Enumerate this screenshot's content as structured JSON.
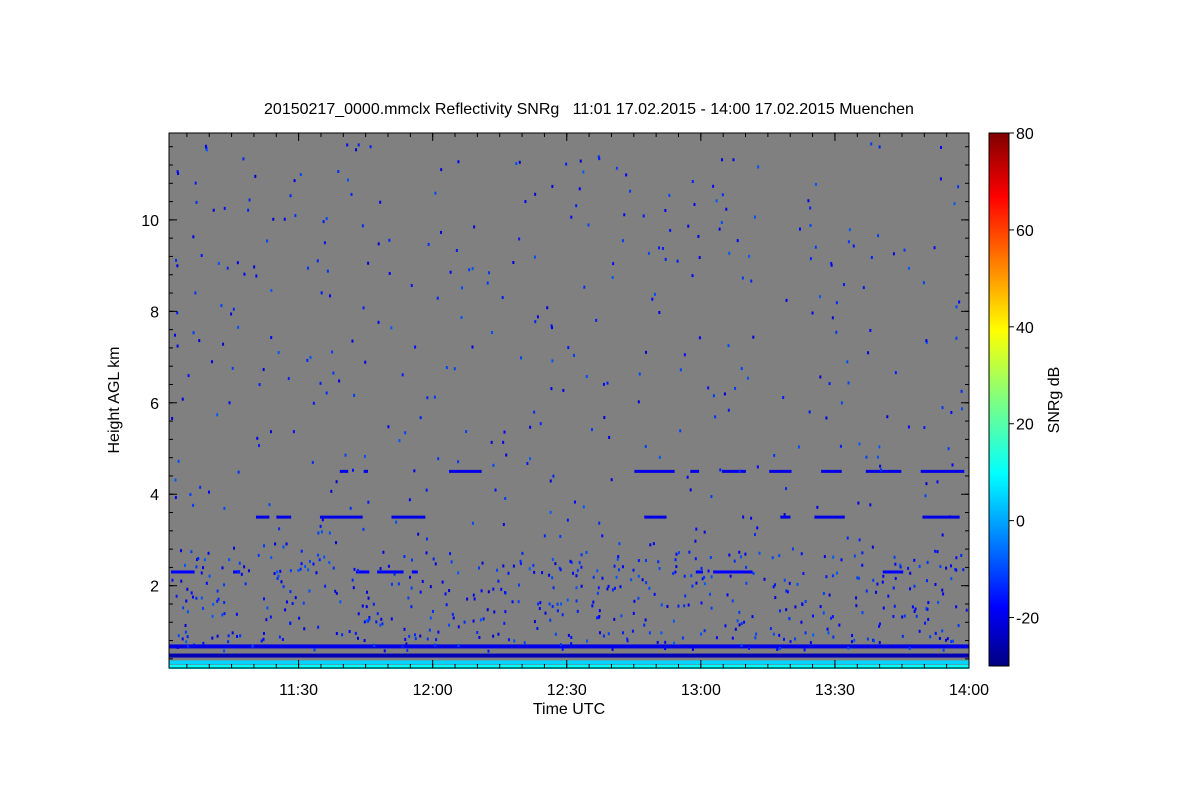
{
  "chart_data": {
    "type": "heatmap",
    "title": "20150217_0000.mmclx Reflectivity SNRg   11:01 17.02.2015 - 14:00 17.02.2015 Muenchen",
    "xlabel": "Time UTC",
    "ylabel": "Height AGL km",
    "xlim": [
      "11:01",
      "14:00"
    ],
    "ylim": [
      0.2,
      11.9
    ],
    "x_ticks": [
      "11:30",
      "12:00",
      "12:30",
      "13:00",
      "13:30",
      "14:00"
    ],
    "y_ticks": [
      "2",
      "4",
      "6",
      "8",
      "10"
    ],
    "background_color": "#808080",
    "colorbar": {
      "label": "SNRg dB",
      "range": [
        -30,
        80
      ],
      "ticks": [
        "-20",
        "0",
        "20",
        "40",
        "60",
        "80"
      ],
      "colormap": "jet"
    },
    "bands": [
      {
        "height_km": 0.2,
        "snr_db": 10
      },
      {
        "height_km": 0.3,
        "snr_db": 5
      },
      {
        "height_km": 0.45,
        "snr_db": -25
      },
      {
        "height_km": 0.65,
        "snr_db": -20
      },
      {
        "height_km": 2.3,
        "snr_db": -18,
        "intermittent": true
      },
      {
        "height_km": 3.5,
        "snr_db": -20,
        "intermittent": true
      },
      {
        "height_km": 4.5,
        "snr_db": -20,
        "intermittent": true
      }
    ]
  }
}
